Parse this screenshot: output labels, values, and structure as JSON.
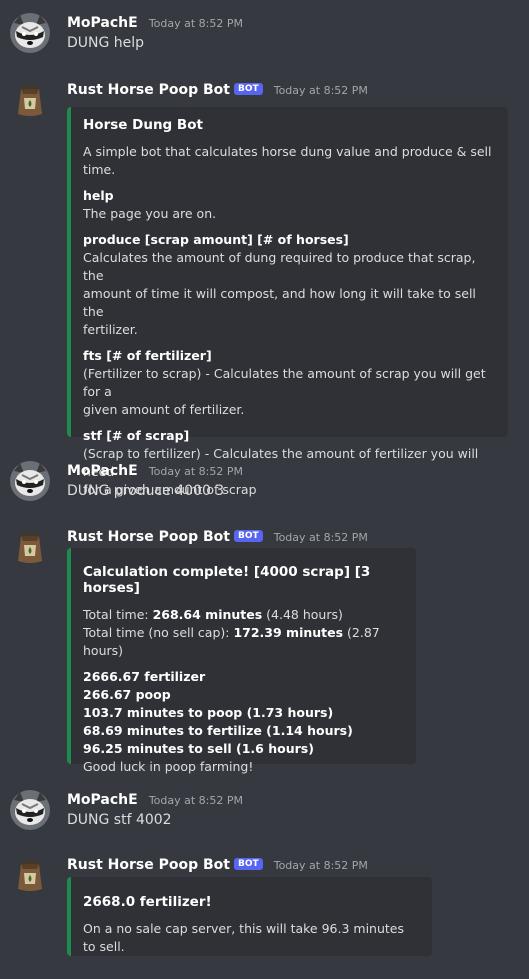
{
  "colors": {
    "background": "#36393f",
    "embed_bg": "#2f3136",
    "embed_accent": "#1f8b4c",
    "bot_tag": "#5865f2"
  },
  "icons": {
    "user_avatar": "raccoon-avatar-icon",
    "bot_avatar": "poop-bag-avatar-icon"
  },
  "messages": [
    {
      "author": "MoPachE",
      "timestamp": "Today at 8:52 PM",
      "content": "DUNG help"
    },
    {
      "author": "Rust Horse Poop Bot",
      "bot_tag": "BOT",
      "timestamp": "Today at 8:52 PM",
      "embed": {
        "title": "Horse Dung Bot",
        "description": "A simple bot that calculates horse dung value and produce & sell time.",
        "fields": [
          {
            "name": "help",
            "value": [
              "The page you are on."
            ]
          },
          {
            "name": "produce [scrap amount] [# of horses]",
            "value": [
              "Calculates the amount of dung required to produce that scrap, the",
              "amount of time it will compost, and how long it will take to sell the",
              "fertilizer."
            ]
          },
          {
            "name": "fts [# of fertilizer]",
            "value": [
              "(Fertilizer to scrap) - Calculates the amount of scrap you will get for a",
              "given amount of fertilizer."
            ]
          },
          {
            "name": "stf [# of scrap]",
            "value": [
              "(Scrap to fertilizer) - Calculates the amount of fertilizer you will need",
              "for a given amount of scrap"
            ]
          }
        ]
      }
    },
    {
      "author": "MoPachE",
      "timestamp": "Today at 8:52 PM",
      "content": "DUNG produce 4000 3"
    },
    {
      "author": "Rust Horse Poop Bot",
      "bot_tag": "BOT",
      "timestamp": "Today at 8:52 PM",
      "embed": {
        "title": "Calculation complete! [4000 scrap] [3 horses]",
        "total_time": {
          "label": "Total time: ",
          "value": "268.64 minutes",
          "extra": " (4.48 hours)"
        },
        "total_time_nocap": {
          "label": "Total time (no sell cap): ",
          "value": "172.39 minutes",
          "extra": " (2.87 hours)"
        },
        "results": [
          "2666.67 fertilizer",
          "266.67 poop",
          "103.7 minutes to poop (1.73 hours)",
          "68.69 minutes to fertilize (1.14 hours)",
          "96.25 minutes to sell (1.6 hours)"
        ],
        "footer_text": "Good luck in poop farming!"
      }
    },
    {
      "author": "MoPachE",
      "timestamp": "Today at 8:52 PM",
      "content": "DUNG stf 4002"
    },
    {
      "author": "Rust Horse Poop Bot",
      "bot_tag": "BOT",
      "timestamp": "Today at 8:52 PM",
      "embed": {
        "title": "2668.0 fertilizer!",
        "description": "On a no sale cap server, this will take 96.3 minutes to sell."
      }
    }
  ]
}
